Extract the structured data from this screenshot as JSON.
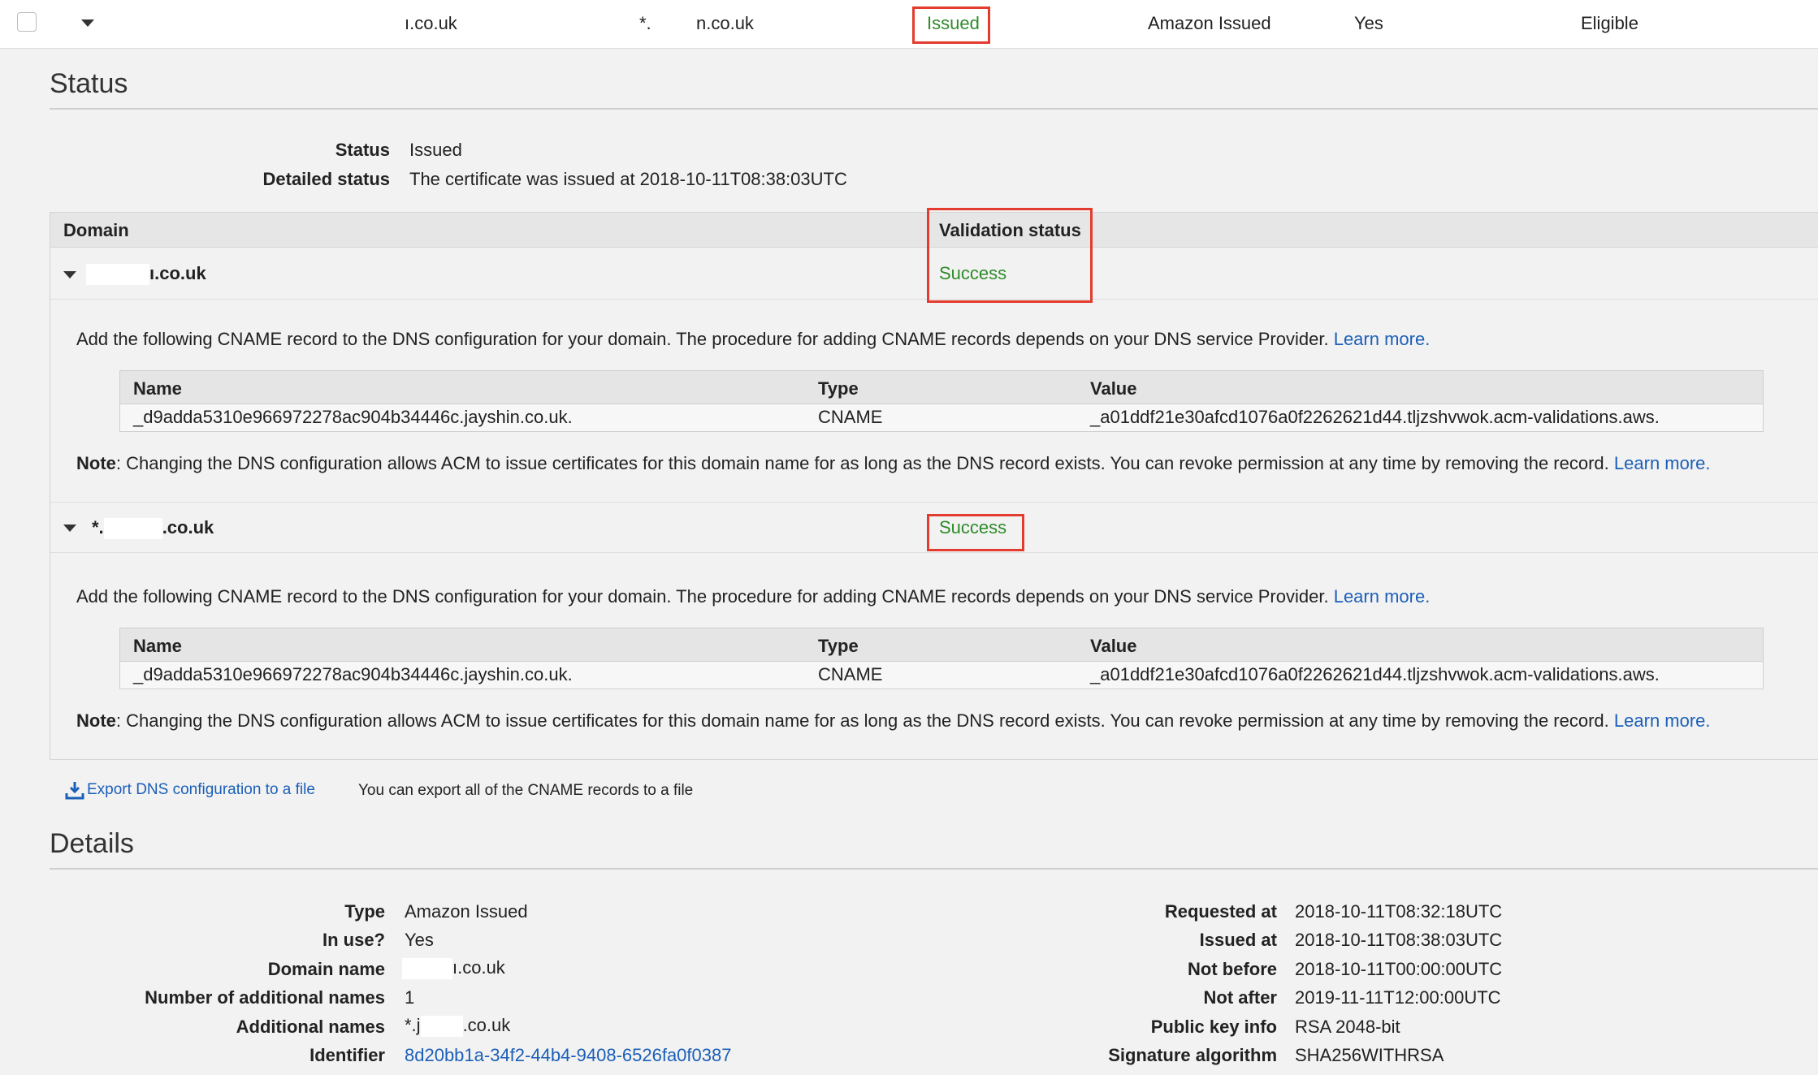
{
  "cert_row": {
    "domain_suffix": "ı.co.uk",
    "additional_prefix": "*.",
    "additional_suffix": "n.co.uk",
    "status": "Issued",
    "type": "Amazon Issued",
    "in_use": "Yes",
    "renewal": "Eligible"
  },
  "status_section": {
    "title": "Status",
    "status_label": "Status",
    "status_value": "Issued",
    "detailed_label": "Detailed status",
    "detailed_value": "The certificate was issued at 2018-10-11T08:38:03UTC"
  },
  "domain_table": {
    "col_domain": "Domain",
    "col_validation": "Validation status",
    "rows": [
      {
        "domain": "ı.co.uk",
        "status": "Success",
        "instruction": "Add the following CNAME record to the DNS configuration for your domain. The procedure for adding CNAME records depends on your DNS service Provider.",
        "learn_more": "Learn more.",
        "record": {
          "h_name": "Name",
          "h_type": "Type",
          "h_value": "Value",
          "name": "_d9adda5310e966972278ac904b34446c.jayshin.co.uk.",
          "type": "CNAME",
          "value": "_a01ddf21e30afcd1076a0f2262621d44.tljzshvwok.acm-validations.aws."
        },
        "note_label": "Note",
        "note_text": ": Changing the DNS configuration allows ACM to issue certificates for this domain name for as long as the DNS record exists. You can revoke permission at any time by removing the record.",
        "note_link": "Learn more."
      },
      {
        "domain_prefix": "*.",
        "domain_suffix": ".co.uk",
        "status": "Success",
        "instruction": "Add the following CNAME record to the DNS configuration for your domain. The procedure for adding CNAME records depends on your DNS service Provider.",
        "learn_more": "Learn more.",
        "record": {
          "h_name": "Name",
          "h_type": "Type",
          "h_value": "Value",
          "name": "_d9adda5310e966972278ac904b34446c.jayshin.co.uk.",
          "type": "CNAME",
          "value": "_a01ddf21e30afcd1076a0f2262621d44.tljzshvwok.acm-validations.aws."
        },
        "note_label": "Note",
        "note_text": ": Changing the DNS configuration allows ACM to issue certificates for this domain name for as long as the DNS record exists. You can revoke permission at any time by removing the record.",
        "note_link": "Learn more."
      }
    ]
  },
  "export": {
    "link": "Export DNS configuration to a file",
    "note": "You can export all of the CNAME records to a file"
  },
  "details": {
    "title": "Details",
    "left": [
      {
        "label": "Type",
        "value": "Amazon Issued"
      },
      {
        "label": "In use?",
        "value": "Yes"
      },
      {
        "label": "Domain name",
        "value": "ı.co.uk"
      },
      {
        "label": "Number of additional names",
        "value": "1"
      },
      {
        "label": "Additional names",
        "value_prefix": "*.j",
        "value_suffix": ".co.uk"
      },
      {
        "label": "Identifier",
        "value": "8d20bb1a-34f2-44b4-9408-6526fa0f0387"
      }
    ],
    "right": [
      {
        "label": "Requested at",
        "value": "2018-10-11T08:32:18UTC"
      },
      {
        "label": "Issued at",
        "value": "2018-10-11T08:38:03UTC"
      },
      {
        "label": "Not before",
        "value": "2018-10-11T00:00:00UTC"
      },
      {
        "label": "Not after",
        "value": "2019-11-11T12:00:00UTC"
      },
      {
        "label": "Public key info",
        "value": "RSA 2048-bit"
      },
      {
        "label": "Signature algorithm",
        "value": "SHA256WITHRSA"
      }
    ]
  },
  "colors": {
    "success_green": "#2e8b2a",
    "link_blue": "#1b5fb8",
    "highlight_red": "#e33b2e"
  }
}
